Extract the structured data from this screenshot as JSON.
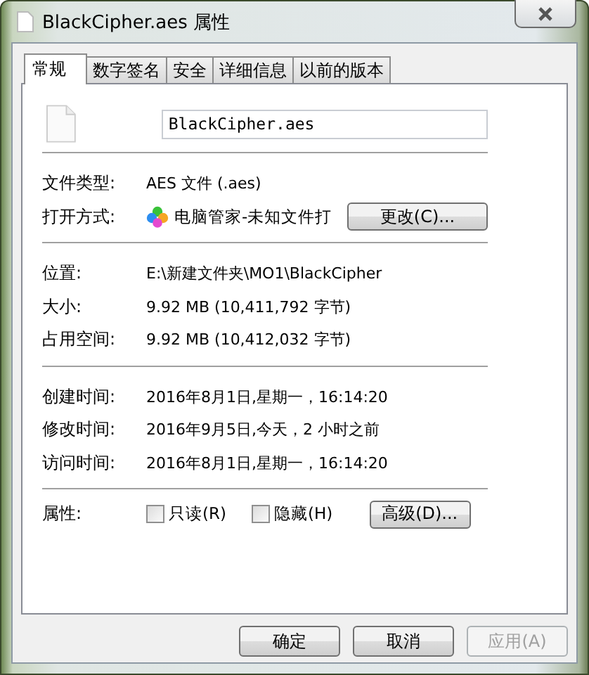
{
  "window": {
    "title": "BlackCipher.aes 属性"
  },
  "tabs": [
    {
      "label": "常规",
      "selected": true
    },
    {
      "label": "数字签名",
      "selected": false
    },
    {
      "label": "安全",
      "selected": false
    },
    {
      "label": "详细信息",
      "selected": false
    },
    {
      "label": "以前的版本",
      "selected": false
    }
  ],
  "file_name": {
    "value": "BlackCipher.aes"
  },
  "groups": [
    [
      {
        "kind": "text",
        "label": "文件类型:",
        "value": "AES 文件 (.aes)"
      },
      {
        "kind": "app",
        "label": "打开方式:",
        "value": "电脑管家-未知文件打",
        "button": "更改(C)..."
      }
    ],
    [
      {
        "kind": "text",
        "label": "位置:",
        "value": "E:\\新建文件夹\\MO1\\BlackCipher"
      },
      {
        "kind": "text",
        "label": "大小:",
        "value": "9.92 MB (10,411,792 字节)"
      },
      {
        "kind": "text",
        "label": "占用空间:",
        "value": "9.92 MB (10,412,032 字节)"
      }
    ],
    [
      {
        "kind": "text",
        "label": "创建时间:",
        "value": "2016年8月1日,星期一，16:14:20"
      },
      {
        "kind": "text",
        "label": "修改时间:",
        "value": "2016年9月5日,今天，2 小时之前"
      },
      {
        "kind": "text",
        "label": "访问时间:",
        "value": "2016年8月1日,星期一，16:14:20"
      }
    ]
  ],
  "attributes": {
    "label": "属性:",
    "checkboxes": [
      {
        "label": "只读(R)",
        "checked": false
      },
      {
        "label": "隐藏(H)",
        "checked": false
      }
    ],
    "button": "高级(D)..."
  },
  "buttons": [
    {
      "label": "确定",
      "disabled": false
    },
    {
      "label": "取消",
      "disabled": false
    },
    {
      "label": "应用(A)",
      "disabled": true
    }
  ]
}
